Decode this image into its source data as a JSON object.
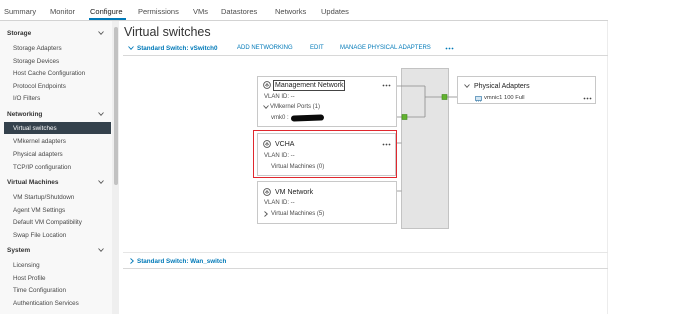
{
  "colors": {
    "accent": "#0079b8",
    "selected_bg": "#34414c",
    "highlight_red": "#e0282e",
    "port_green": "#62b22f"
  },
  "icons": {
    "expand": "chevron-down-icon",
    "collapse": "chevron-right-icon",
    "more_actions": "ellipsis-icon",
    "port_group": "port-group-icon",
    "physical_nic": "nic-icon"
  },
  "tabs": [
    "Summary",
    "Monitor",
    "Configure",
    "Permissions",
    "VMs",
    "Datastores",
    "Networks",
    "Updates"
  ],
  "active_tab": "Configure",
  "sidebar": {
    "selected_item": "Virtual switches",
    "sections": [
      {
        "title": "Storage",
        "expanded": true,
        "items": [
          "Storage Adapters",
          "Storage Devices",
          "Host Cache Configuration",
          "Protocol Endpoints",
          "I/O Filters"
        ]
      },
      {
        "title": "Networking",
        "expanded": true,
        "items": [
          "Virtual switches",
          "VMkernel adapters",
          "Physical adapters",
          "TCP/IP configuration"
        ]
      },
      {
        "title": "Virtual Machines",
        "expanded": true,
        "items": [
          "VM Startup/Shutdown",
          "Agent VM Settings",
          "Default VM Compatibility",
          "Swap File Location"
        ]
      },
      {
        "title": "System",
        "expanded": true,
        "items": [
          "Licensing",
          "Host Profile",
          "Time Configuration",
          "Authentication Services"
        ]
      }
    ]
  },
  "main": {
    "title": "Virtual switches",
    "switches": [
      {
        "label": "Standard Switch: vSwitch0",
        "expanded": true,
        "actions": {
          "add_networking": "ADD NETWORKING",
          "edit": "EDIT",
          "manage_physical_adapters": "MANAGE PHYSICAL ADAPTERS"
        },
        "port_groups": [
          {
            "name": "Management Network",
            "vlan": "VLAN ID: --",
            "detail": "VMkernel Ports (1)",
            "detail_expanded": true,
            "sub_item": "vmk0 :",
            "highlighted": false
          },
          {
            "name": "VCHA",
            "vlan": "VLAN ID: --",
            "detail": "Virtual Machines (0)",
            "highlighted": true
          },
          {
            "name": "VM Network",
            "vlan": "VLAN ID: --",
            "detail": "Virtual Machines (5)",
            "detail_expanded": false,
            "highlighted": false
          }
        ],
        "physical_adapters": {
          "title": "Physical Adapters",
          "expanded": true,
          "items": [
            "vmnic1 100 Full"
          ]
        }
      },
      {
        "label": "Standard Switch: Wan_switch",
        "expanded": false
      }
    ]
  }
}
